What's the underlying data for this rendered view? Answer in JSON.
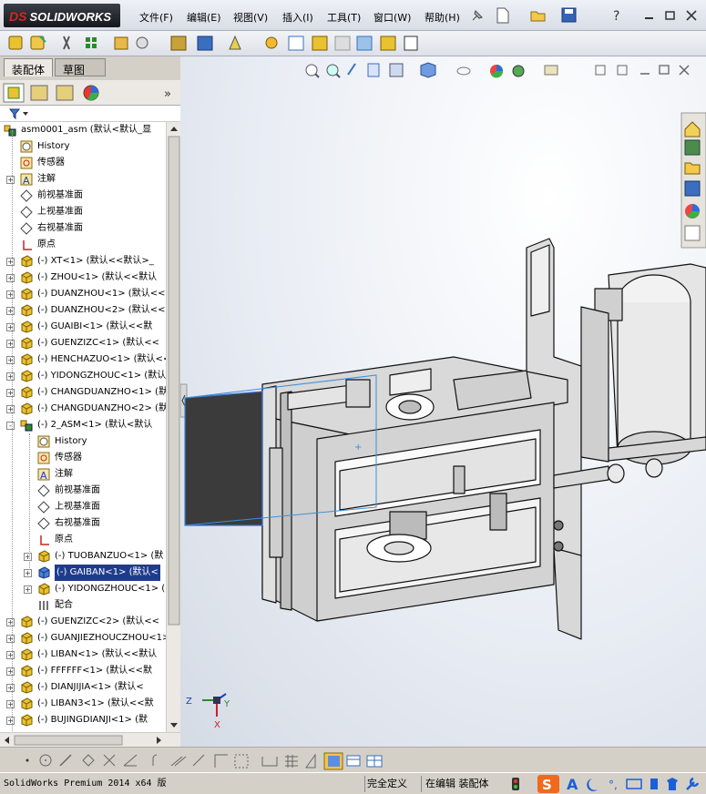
{
  "app": {
    "logo": "SOLIDWORKS",
    "logo_prefix": "DS"
  },
  "menu": [
    "文件(F)",
    "编辑(E)",
    "视图(V)",
    "插入(I)",
    "工具(T)",
    "窗口(W)",
    "帮助(H)"
  ],
  "left_panel": {
    "tabs": [
      "装配体",
      "草图"
    ],
    "tree": [
      {
        "label": "asm0001_asm  (默认<默认_显",
        "level": 0,
        "icon": "assembly",
        "exp": ""
      },
      {
        "label": "History",
        "level": 1,
        "icon": "history",
        "exp": ""
      },
      {
        "label": "传感器",
        "level": 1,
        "icon": "sensor",
        "exp": ""
      },
      {
        "label": "注解",
        "level": 1,
        "icon": "annotation",
        "exp": "+"
      },
      {
        "label": "前视基准面",
        "level": 1,
        "icon": "plane",
        "exp": ""
      },
      {
        "label": "上视基准面",
        "level": 1,
        "icon": "plane",
        "exp": ""
      },
      {
        "label": "右视基准面",
        "level": 1,
        "icon": "plane",
        "exp": ""
      },
      {
        "label": "原点",
        "level": 1,
        "icon": "origin",
        "exp": ""
      },
      {
        "label": "(-) XT<1> (默认<<默认>_",
        "level": 1,
        "icon": "part",
        "exp": "+"
      },
      {
        "label": "(-) ZHOU<1> (默认<<默认",
        "level": 1,
        "icon": "part",
        "exp": "+"
      },
      {
        "label": "(-) DUANZHOU<1> (默认<<",
        "level": 1,
        "icon": "part",
        "exp": "+"
      },
      {
        "label": "(-) DUANZHOU<2> (默认<<",
        "level": 1,
        "icon": "part",
        "exp": "+"
      },
      {
        "label": "(-) GUAIBI<1> (默认<<默",
        "level": 1,
        "icon": "part",
        "exp": "+"
      },
      {
        "label": "(-) GUENZIZC<1> (默认<<",
        "level": 1,
        "icon": "part",
        "exp": "+"
      },
      {
        "label": "(-) HENCHAZUO<1> (默认<<",
        "level": 1,
        "icon": "part",
        "exp": "+"
      },
      {
        "label": "(-) YIDONGZHOUC<1> (默认",
        "level": 1,
        "icon": "part",
        "exp": "+"
      },
      {
        "label": "(-) CHANGDUANZHO<1> (默",
        "level": 1,
        "icon": "part",
        "exp": "+"
      },
      {
        "label": "(-) CHANGDUANZHO<2> (默",
        "level": 1,
        "icon": "part",
        "exp": "+"
      },
      {
        "label": "(-) 2_ASM<1> (默认<默认",
        "level": 1,
        "icon": "assembly",
        "exp": "-"
      },
      {
        "label": "History",
        "level": 2,
        "icon": "history",
        "exp": ""
      },
      {
        "label": "传感器",
        "level": 2,
        "icon": "sensor",
        "exp": ""
      },
      {
        "label": "注解",
        "level": 2,
        "icon": "annotation",
        "exp": ""
      },
      {
        "label": "前视基准面",
        "level": 2,
        "icon": "plane",
        "exp": ""
      },
      {
        "label": "上视基准面",
        "level": 2,
        "icon": "plane",
        "exp": ""
      },
      {
        "label": "右视基准面",
        "level": 2,
        "icon": "plane",
        "exp": ""
      },
      {
        "label": "原点",
        "level": 2,
        "icon": "origin",
        "exp": ""
      },
      {
        "label": "(-) TUOBANZUO<1> (默",
        "level": 2,
        "icon": "part",
        "exp": "+"
      },
      {
        "label": "(-) GAIBAN<1> (默认<",
        "level": 2,
        "icon": "part-blue",
        "exp": "+",
        "selected": true
      },
      {
        "label": "(-) YIDONGZHOUC<1> (",
        "level": 2,
        "icon": "part",
        "exp": "+"
      },
      {
        "label": "配合",
        "level": 2,
        "icon": "mates",
        "exp": ""
      },
      {
        "label": "(-) GUENZIZC<2> (默认<<",
        "level": 1,
        "icon": "part",
        "exp": "+"
      },
      {
        "label": "(-) GUANJIEZHOUCZHOU<1>",
        "level": 1,
        "icon": "part",
        "exp": "+"
      },
      {
        "label": "(-) LIBAN<1> (默认<<默认",
        "level": 1,
        "icon": "part",
        "exp": "+"
      },
      {
        "label": "(-) FFFFFF<1> (默认<<默",
        "level": 1,
        "icon": "part",
        "exp": "+"
      },
      {
        "label": "(-) DIANJIJIA<1> (默认<",
        "level": 1,
        "icon": "part",
        "exp": "+"
      },
      {
        "label": "(-) LIBAN3<1> (默认<<默",
        "level": 1,
        "icon": "part",
        "exp": "+"
      },
      {
        "label": "(-) BUJINGDIANJI<1> (默",
        "level": 1,
        "icon": "part",
        "exp": "+"
      }
    ]
  },
  "statusbar": {
    "product": "SolidWorks Premium 2014 x64 版",
    "definition": "完全定义",
    "mode": "在编辑 装配体"
  },
  "triad": {
    "x": "X",
    "y": "Y",
    "z": "Z"
  },
  "colors": {
    "selection": "#1f3c8c",
    "accent": "#d22222"
  }
}
